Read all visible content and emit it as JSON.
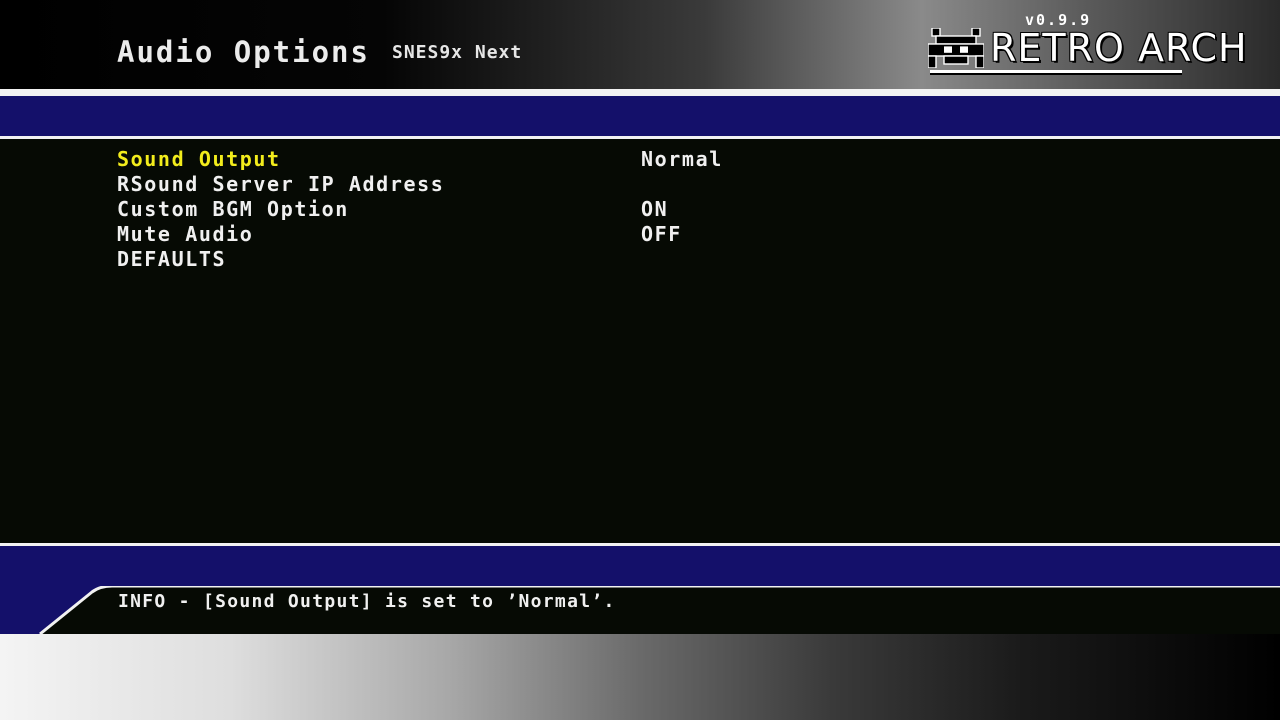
{
  "header": {
    "title": "Audio Options",
    "core_name": "SNES9x Next",
    "logo": {
      "version": "v0.9.9",
      "text": "RETRO ARCH"
    }
  },
  "menu": {
    "items": [
      {
        "label": "Sound Output",
        "value": "Normal",
        "selected": true
      },
      {
        "label": "RSound Server IP Address",
        "value": ""
      },
      {
        "label": "Custom BGM Option",
        "value": "ON"
      },
      {
        "label": "Mute Audio",
        "value": "OFF"
      },
      {
        "label": "DEFAULTS",
        "value": ""
      }
    ]
  },
  "info": {
    "message": "INFO - [Sound Output] is set to ’Normal’."
  },
  "colors": {
    "band_blue": "#14106a",
    "selected_text": "#f2ec1c",
    "normal_text": "#f0f0f0",
    "background": "#060a04"
  }
}
